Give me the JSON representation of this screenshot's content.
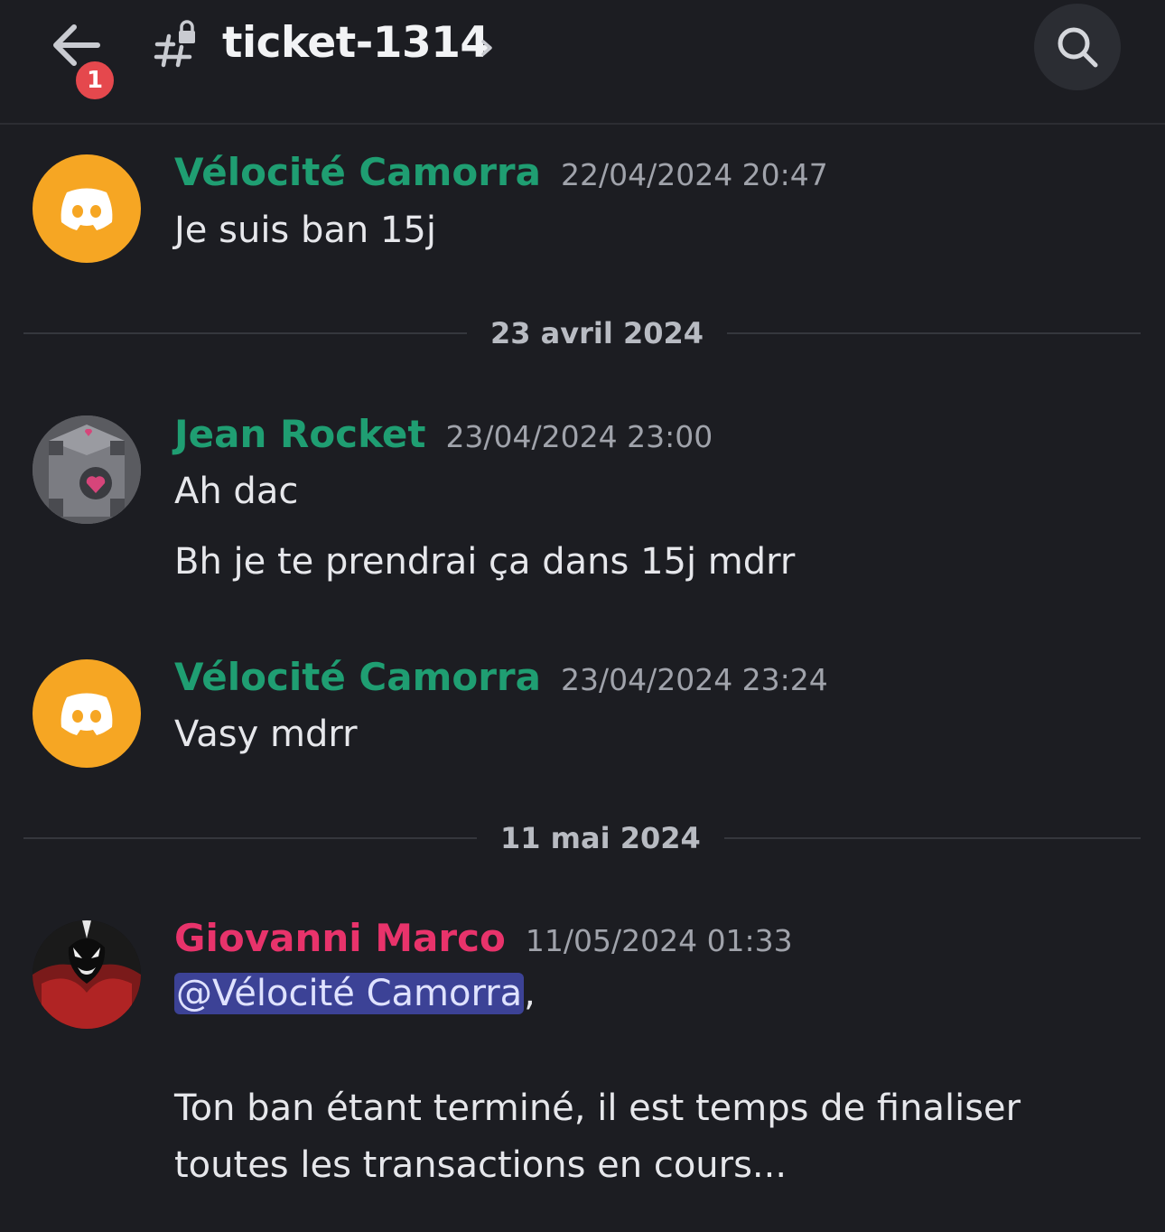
{
  "header": {
    "unread_count": "1",
    "channel_name": "ticket-1314"
  },
  "messages": [
    {
      "author": "Vélocité Camorra",
      "author_color": "#1f9e72",
      "timestamp": "22/04/2024 20:47",
      "lines": [
        "Je suis ban 15j"
      ],
      "avatar": "discord-logo-icon"
    },
    {
      "author": "Jean Rocket",
      "author_color": "#1f9e72",
      "timestamp": "23/04/2024 23:00",
      "lines": [
        "Ah dac",
        "Bh je te prendrai ça dans 15j mdrr"
      ],
      "avatar": "companion-cube-avatar"
    },
    {
      "author": "Vélocité Camorra",
      "author_color": "#1f9e72",
      "timestamp": "23/04/2024 23:24",
      "lines": [
        "Vasy mdrr"
      ],
      "avatar": "discord-logo-icon"
    },
    {
      "author": "Giovanni Marco",
      "author_color": "#e8336b",
      "timestamp": "11/05/2024 01:33",
      "mention": "@Vélocité Camorra",
      "mention_suffix": ",",
      "lines": [
        "Ton ban étant terminé, il est temps de finaliser",
        "toutes les transactions en cours..."
      ],
      "avatar": "venom-avatar"
    }
  ],
  "dividers": [
    "23 avril 2024",
    "11 mai 2024"
  ]
}
